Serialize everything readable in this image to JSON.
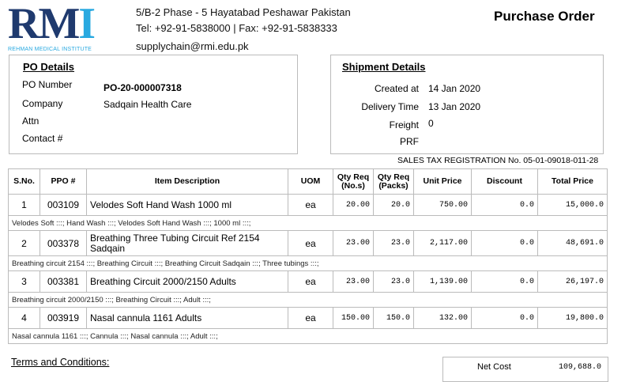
{
  "logo": {
    "letters_rm": "RM",
    "letters_i": "I",
    "subtitle": "REHMAN MEDICAL INSTITUTE"
  },
  "header": {
    "address": "5/B-2 Phase - 5 Hayatabad Peshawar Pakistan",
    "phone": "Tel: +92-91-5838000 | Fax: +92-91-5838333",
    "email": "supplychain@rmi.edu.pk",
    "doc_title": "Purchase Order"
  },
  "po_details": {
    "title": "PO Details",
    "po_number_label": "PO Number",
    "po_number": "PO-20-000007318",
    "company_label": "Company",
    "company": "Sadqain Health Care",
    "attn_label": "Attn",
    "contact_label": "Contact #"
  },
  "shipment": {
    "title": "Shipment Details",
    "created_label": "Created at",
    "created": "14 Jan 2020",
    "delivery_label": "Delivery Time",
    "delivery": "13 Jan 2020",
    "freight_label": "Freight",
    "freight": "0",
    "prf_label": "PRF"
  },
  "tax_registration": "SALES TAX REGISTRATION No. 05-01-09018-011-28",
  "table": {
    "headers": {
      "sno": "S.No.",
      "ppo": "PPO #",
      "desc": "Item Description",
      "uom": "UOM",
      "qty_nos_1": "Qty Req",
      "qty_nos_2": "(No.s)",
      "qty_packs_1": "Qty Req",
      "qty_packs_2": "(Packs)",
      "unit_price": "Unit Price",
      "discount": "Discount",
      "total": "Total Price"
    },
    "rows": [
      {
        "sno": "1",
        "ppo": "003109",
        "desc": "Velodes Soft Hand Wash 1000 ml",
        "uom": "ea",
        "qty_nos": "20.00",
        "qty_packs": "20.0",
        "unit_price": "750.00",
        "discount": "0.0",
        "total": "15,000.0",
        "tags": "Velodes Soft :::; Hand Wash :::; Velodes Soft Hand Wash :::; 1000 ml :::;"
      },
      {
        "sno": "2",
        "ppo": "003378",
        "desc": "Breathing Three Tubing Circuit Ref 2154 Sadqain",
        "uom": "ea",
        "qty_nos": "23.00",
        "qty_packs": "23.0",
        "unit_price": "2,117.00",
        "discount": "0.0",
        "total": "48,691.0",
        "tags": "Breathing circuit 2154 :::; Breathing Circuit :::; Breathing Circuit Sadqain :::; Three tubings :::;"
      },
      {
        "sno": "3",
        "ppo": "003381",
        "desc": "Breathing Circuit 2000/2150 Adults",
        "uom": "ea",
        "qty_nos": "23.00",
        "qty_packs": "23.0",
        "unit_price": "1,139.00",
        "discount": "0.0",
        "total": "26,197.0",
        "tags": "Breathing circuit 2000/2150 :::; Breathing Circuit :::; Adult :::;"
      },
      {
        "sno": "4",
        "ppo": "003919",
        "desc": "Nasal cannula 1161 Adults",
        "uom": "ea",
        "qty_nos": "150.00",
        "qty_packs": "150.0",
        "unit_price": "132.00",
        "discount": "0.0",
        "total": "19,800.0",
        "tags": "Nasal cannula 1161 :::; Cannula :::; Nasal cannula :::; Adult :::;"
      }
    ]
  },
  "terms_title": "Terms and Conditions:",
  "net_cost_label": "Net Cost",
  "net_cost": "109,688.0",
  "colors": {
    "brand_navy": "#1f3a6e",
    "brand_cyan": "#29a9e0",
    "border": "#bbbbbb"
  }
}
